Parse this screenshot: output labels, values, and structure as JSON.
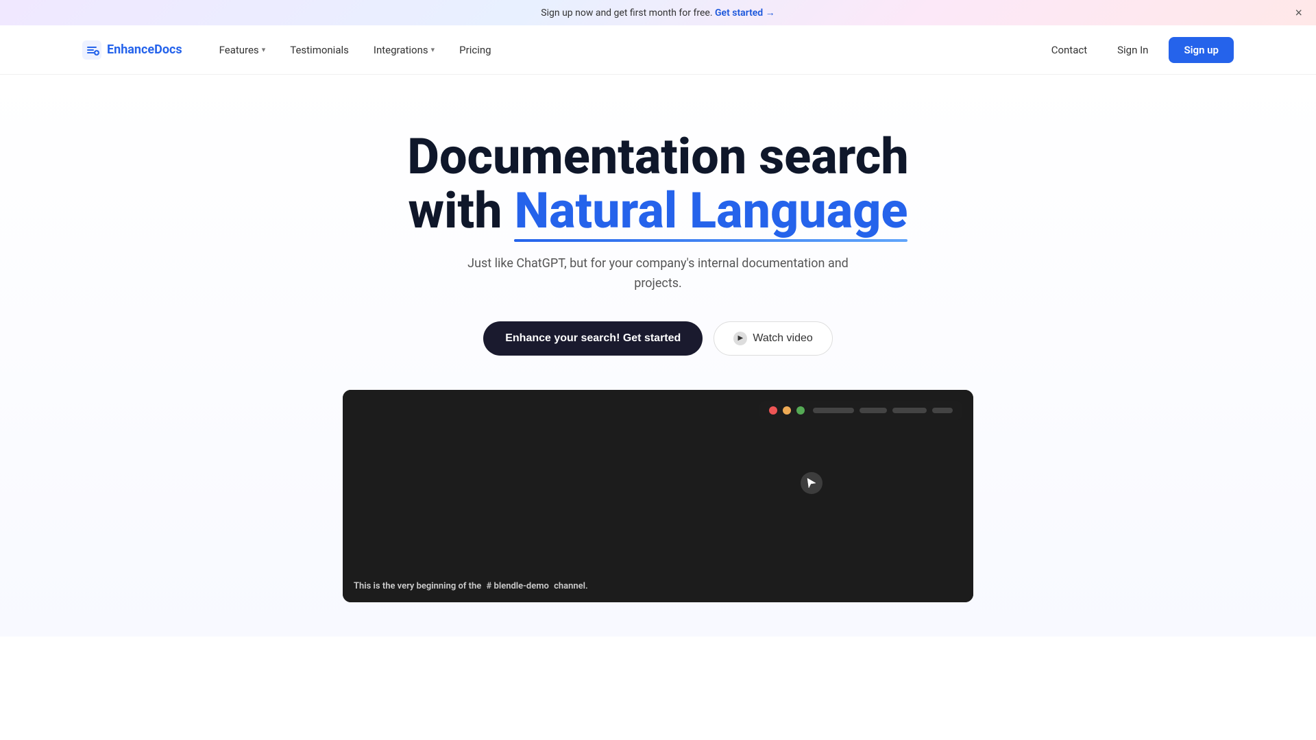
{
  "banner": {
    "text": "Sign up now and get first month for free.",
    "cta_text": "Get started →",
    "close_label": "×"
  },
  "navbar": {
    "logo_text_part1": "Enhance",
    "logo_text_part2": "Docs",
    "nav_items": [
      {
        "label": "Features",
        "has_chevron": true
      },
      {
        "label": "Testimonials",
        "has_chevron": false
      },
      {
        "label": "Integrations",
        "has_chevron": true
      },
      {
        "label": "Pricing",
        "has_chevron": false
      }
    ],
    "contact_label": "Contact",
    "signin_label": "Sign In",
    "signup_label": "Sign up"
  },
  "hero": {
    "title_part1": "Documentation search",
    "title_part2": "with ",
    "title_highlight": "Natural Language",
    "subtitle": "Just like ChatGPT, but for your company's internal documentation and projects.",
    "cta_primary": "Enhance your search! Get started",
    "cta_video": "Watch video"
  },
  "video": {
    "caption_prefix": "This is the very beginning of the",
    "caption_channel": "# blendle-demo",
    "caption_suffix": "channel.",
    "dots": [
      {
        "color": "#e55"
      },
      {
        "color": "#ea5"
      },
      {
        "color": "#5a5"
      }
    ]
  }
}
